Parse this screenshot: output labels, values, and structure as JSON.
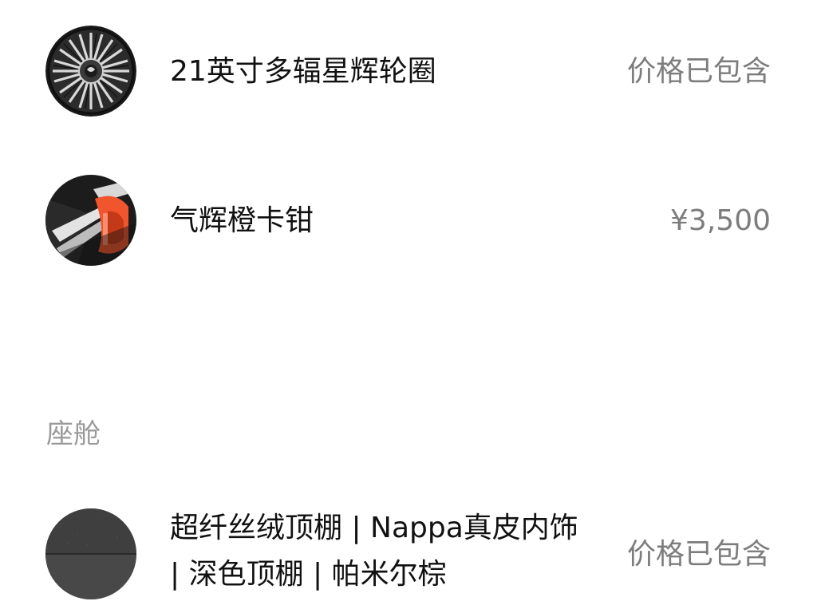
{
  "options": [
    {
      "name": "21英寸多辐星辉轮圈",
      "price": "价格已包含",
      "icon": "wheel-rim-icon"
    },
    {
      "name": "气辉橙卡钳",
      "price": "¥3,500",
      "icon": "orange-caliper-icon"
    }
  ],
  "section": {
    "title": "座舱"
  },
  "cabin_options": [
    {
      "name": "超纤丝绒顶棚 | Nappa真皮内饰 | 深色顶棚 | 帕米尔棕",
      "price": "价格已包含",
      "icon": "dark-headliner-swatch-icon"
    }
  ],
  "colors": {
    "caliper_orange": "#f0552d",
    "headliner_dark": "#3a3a3a",
    "price_gray": "#7d7d7d",
    "section_gray": "#9a9a9a"
  }
}
